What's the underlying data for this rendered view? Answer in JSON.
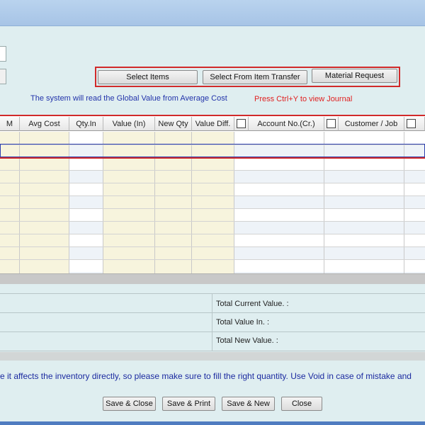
{
  "toolbar": {
    "select_items": "Select Items",
    "select_from_item_transfer": "Select From Item Transfer",
    "material_request": "Material Request"
  },
  "info": {
    "global_value_note": "The system will read the Global Value from Average Cost",
    "journal_hint": "Press Ctrl+Y to view Journal"
  },
  "grid": {
    "headers": {
      "uom": "M",
      "avg_cost": "Avg Cost",
      "qty_in": "Qty.In",
      "value_in": "Value (In)",
      "new_qty": "New Qty",
      "value_diff": "Value Diff.",
      "account_no": "Account No.(Cr.)",
      "customer_job": "Customer / Job"
    }
  },
  "totals": {
    "current_value": "Total Current Value. :",
    "value_in": "Total Value In. :",
    "new_value": "Total New Value. :"
  },
  "warning": "e it affects the inventory directly, so please make sure to fill the right quantity. Use Void in case of mistake and",
  "footer": {
    "save_close": "Save & Close",
    "save_print": "Save & Print",
    "save_new": "Save & New",
    "close": "Close"
  },
  "colors": {
    "highlight_red": "#d12a2a",
    "info_blue": "#2233aa",
    "hint_red": "#e02020",
    "yellow_column": "#f7f4dd",
    "alt_row": "#eef3f8"
  }
}
